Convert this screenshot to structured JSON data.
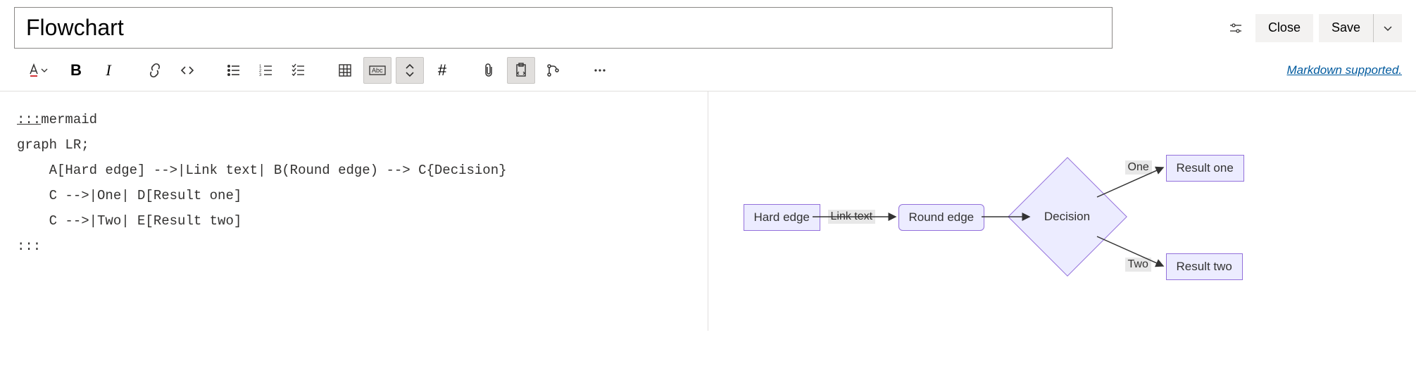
{
  "header": {
    "title_value": "Flowchart",
    "close_label": "Close",
    "save_label": "Save"
  },
  "toolbar": {
    "markdown_link": "Markdown supported."
  },
  "editor": {
    "fence_open": ":::",
    "lang": "mermaid",
    "line1": "graph LR;",
    "line2": "    A[Hard edge] -->|Link text| B(Round edge) --> C{Decision}",
    "line3": "    C -->|One| D[Result one]",
    "line4": "    C -->|Two| E[Result two]",
    "fence_close": ":::"
  },
  "diagram": {
    "nodes": {
      "a": "Hard edge",
      "b": "Round edge",
      "c": "Decision",
      "d": "Result one",
      "e": "Result two"
    },
    "edges": {
      "ab": "Link text",
      "cd": "One",
      "ce": "Two"
    }
  }
}
